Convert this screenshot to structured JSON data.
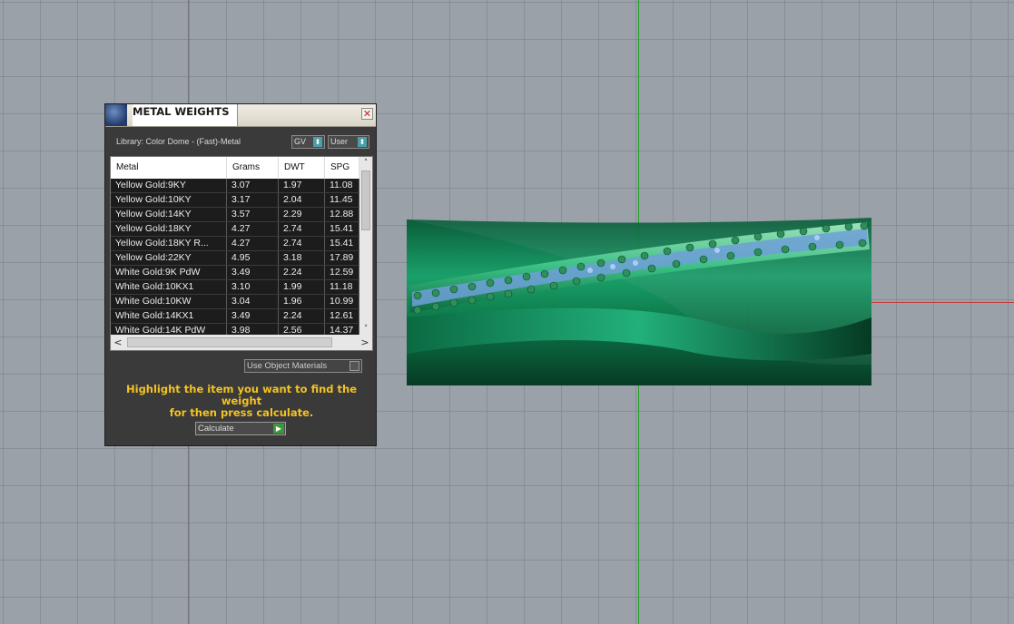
{
  "dialog": {
    "title": "METAL WEIGHTS",
    "close_glyph": "✕",
    "library_label": "Library: Color Dome - (Fast)-Metal",
    "gv_dropdown": "GV",
    "user_dropdown": "User",
    "dropdown_arrow": "⬍",
    "columns": [
      "Metal",
      "Grams",
      "DWT",
      "SPG"
    ],
    "rows": [
      [
        "Yellow Gold:9KY",
        "3.07",
        "1.97",
        "11.08"
      ],
      [
        "Yellow Gold:10KY",
        "3.17",
        "2.04",
        "11.45"
      ],
      [
        "Yellow Gold:14KY",
        "3.57",
        "2.29",
        "12.88"
      ],
      [
        "Yellow Gold:18KY",
        "4.27",
        "2.74",
        "15.41"
      ],
      [
        "Yellow Gold:18KY R...",
        "4.27",
        "2.74",
        "15.41"
      ],
      [
        "Yellow Gold:22KY",
        "4.95",
        "3.18",
        "17.89"
      ],
      [
        "White Gold:9K PdW",
        "3.49",
        "2.24",
        "12.59"
      ],
      [
        "White Gold:10KX1",
        "3.10",
        "1.99",
        "11.18"
      ],
      [
        "White Gold:10KW",
        "3.04",
        "1.96",
        "10.99"
      ],
      [
        "White Gold:14KX1",
        "3.49",
        "2.24",
        "12.61"
      ],
      [
        "White Gold:14K PdW",
        "3.98",
        "2.56",
        "14.37"
      ]
    ],
    "scroll_up": "˄",
    "scroll_down": "˅",
    "scroll_left": "<",
    "scroll_right": ">",
    "use_object_materials": "Use Object Materials",
    "hint_line1": "Highlight the item you want to find the weight",
    "hint_line2": "for then press calculate.",
    "calculate_label": "Calculate",
    "calculate_arrow": "▶"
  },
  "colors": {
    "viewport_bg": "#9aa1a8",
    "axis_y": "#1fa31f",
    "axis_x": "#c43a3a",
    "hint_text": "#f4c322",
    "ring_green": "#0d7a4a"
  }
}
